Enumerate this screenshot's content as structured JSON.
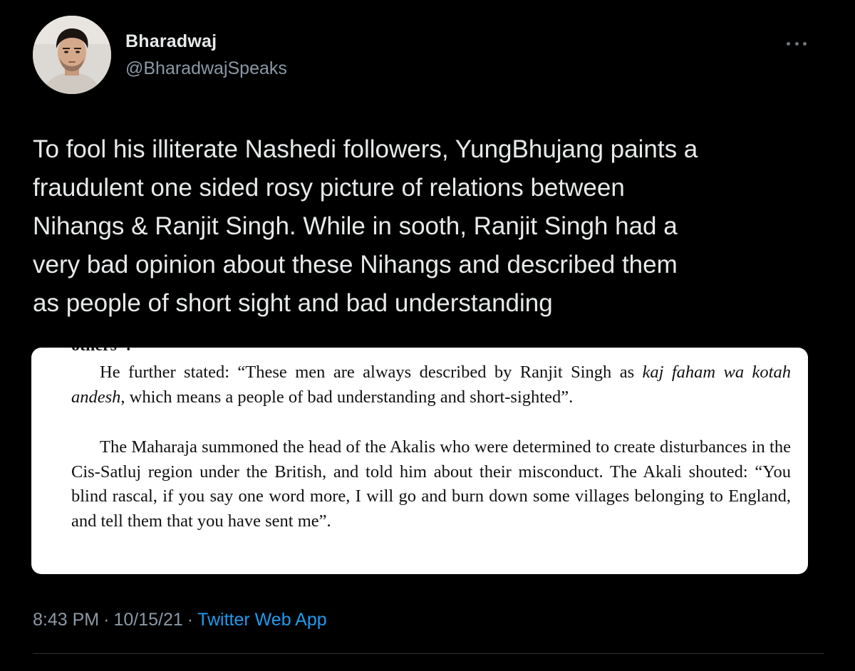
{
  "author": {
    "display_name": "Bharadwaj",
    "handle": "@BharadwajSpeaks",
    "avatar_icon": "profile-photo"
  },
  "tweet": {
    "text": "To fool his illiterate Nashedi followers, YungBhujang paints a\nfraudulent one sided rosy picture of relations between\nNihangs & Ranjit Singh. While in sooth, Ranjit Singh had a\nvery bad opinion about these Nihangs and described them\nas people of short sight and bad understanding"
  },
  "media": {
    "cut_off_text": "others\".",
    "paragraph1": {
      "lead": "He further stated: “These men are always described by Ranjit Singh as ",
      "italic": "kaj faham wa kotah andesh",
      "tail": ", which means a people of bad understanding and short-sighted”."
    },
    "paragraph2": "The Maharaja summoned the head of the Akalis who were determined to create disturbances in the Cis-Satluj region under the British, and told him about their misconduct. The Akali shouted: “You blind rascal, if you say one word more, I will go and burn down some villages belonging to England, and tell them that you have sent me”."
  },
  "meta": {
    "time": "8:43 PM",
    "separator": "·",
    "date": "10/15/21",
    "source": "Twitter Web App"
  },
  "colors": {
    "background": "#000000",
    "text": "#e7e9ea",
    "secondary": "#8b98a5",
    "link": "#1d9bf0"
  }
}
